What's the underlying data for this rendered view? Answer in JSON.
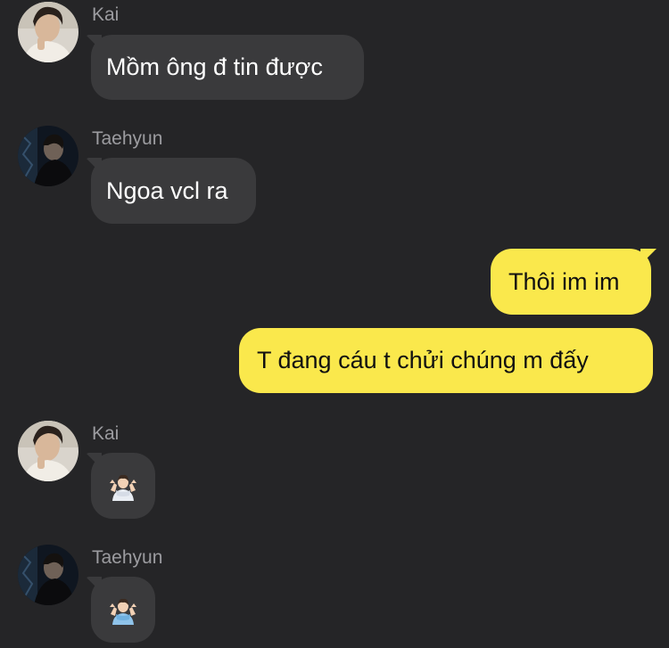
{
  "messages": [
    {
      "sender": "Kai",
      "text": "Mồm ông đ tin được",
      "direction": "incoming"
    },
    {
      "sender": "Taehyun",
      "text": "Ngoa vcl ra",
      "direction": "incoming"
    },
    {
      "text": "Thôi im im",
      "direction": "outgoing"
    },
    {
      "text": "T đang cáu t chửi chúng m đấy",
      "direction": "outgoing"
    },
    {
      "sender": "Kai",
      "emoji": "person-shrugging-emoji",
      "direction": "incoming"
    },
    {
      "sender": "Taehyun",
      "emoji": "person-shrugging-emoji",
      "direction": "incoming"
    }
  ],
  "colors": {
    "background": "#252527",
    "incoming_bubble": "#3a3a3c",
    "outgoing_bubble": "#fae84c",
    "sender_name": "#9c9ca0"
  }
}
